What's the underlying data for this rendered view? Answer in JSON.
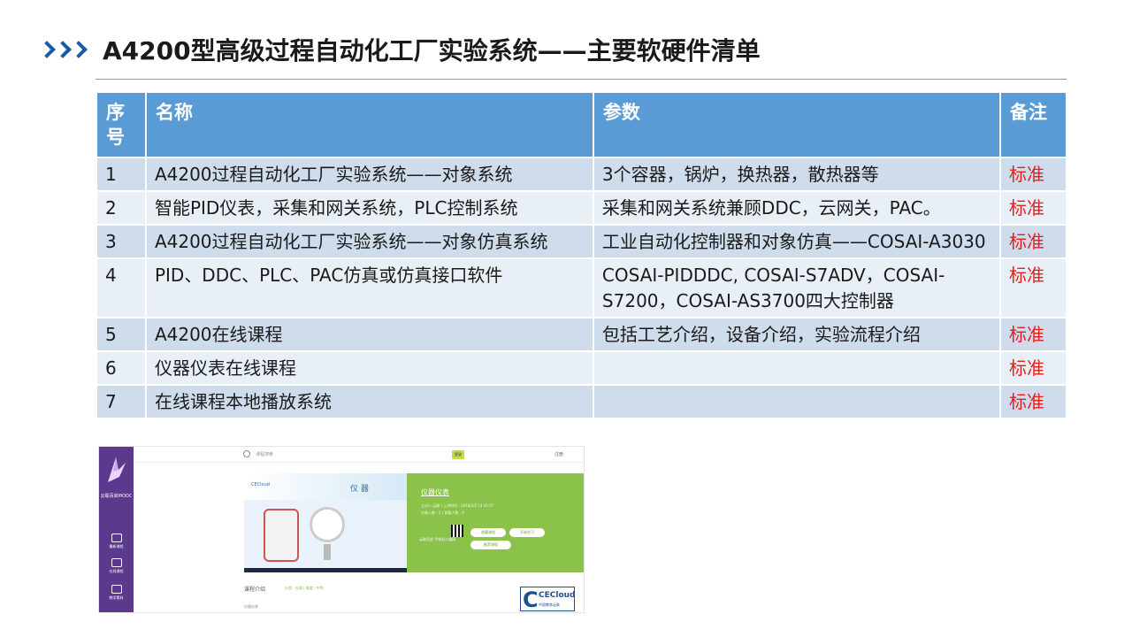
{
  "title": "A4200型高级过程自动化工厂实验系统——主要软硬件清单",
  "table": {
    "headers": {
      "no": "序号",
      "name": "名称",
      "param": "参数",
      "note": "备注"
    },
    "rows": [
      {
        "no": "1",
        "name": "A4200过程自动化工厂实验系统——对象系统",
        "param": "3个容器，锅炉，换热器，散热器等",
        "note": "标准"
      },
      {
        "no": "2",
        "name": "智能PID仪表，采集和网关系统，PLC控制系统",
        "param": "采集和网关系统兼顾DDC，云网关，PAC。",
        "note": "标准"
      },
      {
        "no": "3",
        "name": "A4200过程自动化工厂实验系统——对象仿真系统",
        "param": "工业自动化控制器和对象仿真——COSAI-A3030",
        "note": "标准"
      },
      {
        "no": "4",
        "name": "PID、DDC、PLC、PAC仿真或仿真接口软件",
        "param": "COSAI-PIDDDC, COSAI-S7ADV，COSAI-S7200，COSAI-AS3700四大控制器",
        "note": "标准"
      },
      {
        "no": "5",
        "name": "A4200在线课程",
        "param": "包括工艺介绍，设备介绍，实验流程介绍",
        "note": "标准"
      },
      {
        "no": "6",
        "name": "仪器仪表在线课程",
        "param": "",
        "note": "标准"
      },
      {
        "no": "7",
        "name": "在线课程本地播放系统",
        "param": "",
        "note": "标准"
      }
    ]
  },
  "screenshot": {
    "sidebar_label": "云联百启MOOC",
    "sidebar_items": [
      "最新课程",
      "在线课程",
      "教学素材"
    ],
    "search_placeholder": "课程搜索",
    "login": "登录",
    "user": "注册",
    "course_image_text": "仪 器",
    "course_title": "仪器仪表",
    "course_meta_1": "主讲人:云联 | 上传时间 : 2016/2/2 14:41:07",
    "course_meta_2": "在线人数 : 2 | 观看人数 : 4",
    "qr_label": "云联百启 手机扫二维码",
    "btn_collect": "收藏课程",
    "btn_start": "开始学习",
    "btn_recommend": "推荐课程",
    "intro_label": "课程介绍",
    "intro_meta": "分类 : 仪器 | 难度 : 中等",
    "intro_sub": "仪器仪表",
    "logo_text": "CECloud",
    "logo_sub": "中国教育云联"
  }
}
